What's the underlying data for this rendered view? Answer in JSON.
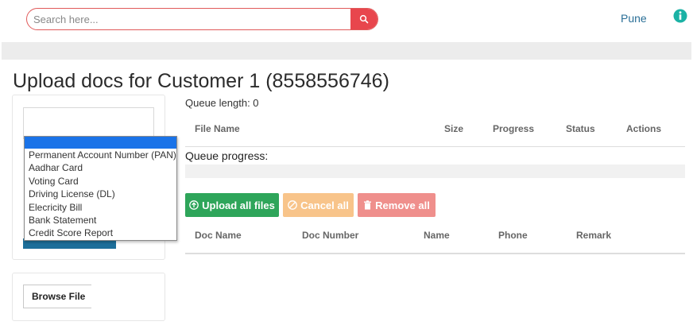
{
  "header": {
    "search_placeholder": "Search here...",
    "city": "Pune"
  },
  "page": {
    "title": "Upload docs for Customer 1 (8558556746)"
  },
  "doc_type_dropdown": {
    "selected": "",
    "options": [
      "Permanent Account Number (PAN)",
      "Aadhar Card",
      "Voting Card",
      "Driving License (DL)",
      "Elecricity Bill",
      "Bank Statement",
      "Credit Score Report"
    ]
  },
  "browse": {
    "label": "Browse File"
  },
  "queue": {
    "length_label": "Queue length: 0",
    "progress_label": "Queue progress:",
    "progress": 0,
    "columns": [
      "File Name",
      "Size",
      "Progress",
      "Status",
      "Actions"
    ]
  },
  "actions": {
    "upload_all": "Upload all files",
    "cancel_all": "Cancel all",
    "remove_all": "Remove all"
  },
  "docs_table": {
    "columns": [
      "Doc Name",
      "Doc Number",
      "Name",
      "Phone",
      "Remark"
    ]
  },
  "colors": {
    "search_button": "#e8464d",
    "upload": "#2ea55a",
    "cancel": "#f8c48a",
    "remove": "#ef8f8c",
    "dropdown_selected": "#1a73e8",
    "info": "#1bb2a5"
  }
}
